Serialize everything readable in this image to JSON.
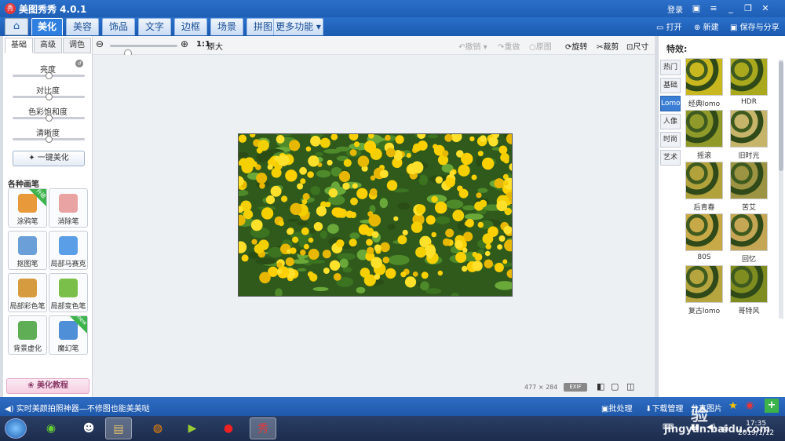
{
  "window": {
    "title": "美图秀秀 4.0.1",
    "login": "登录"
  },
  "menu": {
    "tabs": [
      "美化",
      "美容",
      "饰品",
      "文字",
      "边框",
      "场景",
      "拼图",
      "更多功能"
    ],
    "open": "打开",
    "new": "新建",
    "save": "保存与分享"
  },
  "toolbar": {
    "zoom_fit": "1:1",
    "zoom_orig": "原大",
    "undo": "撤销",
    "redo": "重做",
    "original": "原图",
    "rotate": "旋转",
    "crop": "裁剪",
    "resize": "尺寸"
  },
  "left": {
    "tabs": [
      "基础",
      "高级",
      "调色"
    ],
    "adjust": [
      {
        "label": "亮度",
        "value": 0.5
      },
      {
        "label": "对比度",
        "value": 0.5
      },
      {
        "label": "色彩饱和度",
        "value": 0.5
      },
      {
        "label": "清晰度",
        "value": 0.5
      }
    ],
    "onekey": "一键美化",
    "brush_title": "各种画笔",
    "brushes": [
      {
        "label": "涂鸦笔",
        "badge": "升级",
        "color": "#e89a3a"
      },
      {
        "label": "消除笔",
        "badge": "",
        "color": "#e9a3a3"
      },
      {
        "label": "抠图笔",
        "badge": "",
        "color": "#6a9fd8"
      },
      {
        "label": "局部马赛克",
        "badge": "",
        "color": "#5b9ee8"
      },
      {
        "label": "局部彩色笔",
        "badge": "",
        "color": "#d79b3f"
      },
      {
        "label": "局部变色笔",
        "badge": "",
        "color": "#7abf4a"
      },
      {
        "label": "背景虚化",
        "badge": "",
        "color": "#5fae55"
      },
      {
        "label": "魔幻笔",
        "badge": "new",
        "color": "#4f8fd8"
      }
    ],
    "tutorial": "美化教程"
  },
  "canvas": {
    "size_w": "477",
    "size_x": "×",
    "size_h": "284",
    "exif": "EXIF"
  },
  "right": {
    "title": "特效:",
    "tabs": [
      "热门",
      "基础",
      "Lomo",
      "人像",
      "时尚",
      "艺术"
    ],
    "effects": [
      {
        "label": "经典lomo",
        "tint": "#c9b720"
      },
      {
        "label": "HDR",
        "tint": "#aaa91e"
      },
      {
        "label": "摇滚",
        "tint": "#8f9a2a"
      },
      {
        "label": "旧时光",
        "tint": "#c6b46a"
      },
      {
        "label": "后青春",
        "tint": "#b2a23c"
      },
      {
        "label": "苦艾",
        "tint": "#9c9442"
      },
      {
        "label": "80S",
        "tint": "#c7a948"
      },
      {
        "label": "回忆",
        "tint": "#c5a654"
      },
      {
        "label": "复古lomo",
        "tint": "#b6a53e"
      },
      {
        "label": "哥特风",
        "tint": "#7f8c1f"
      }
    ]
  },
  "status": {
    "message": "实时美颜拍照神器—不修图也能美美哒",
    "batch": "批处理",
    "download": "下载管理",
    "share": "分享图片"
  },
  "taskbar": {
    "time": "17:35",
    "date": "2019/1/12"
  },
  "watermark": {
    "brand": "Baidu 经验",
    "site": "jingyan.baidu.com"
  }
}
